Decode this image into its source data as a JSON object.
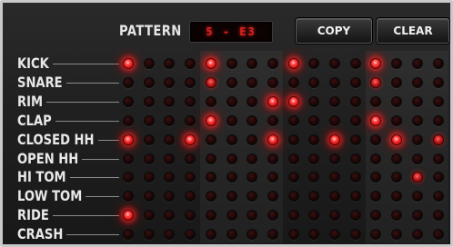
{
  "pattern": {
    "label": "PATTERN",
    "value": "5 - E3"
  },
  "buttons": {
    "copy_label": "COPY",
    "clear_label": "CLEAR"
  },
  "colors": {
    "led_on": "#ff2a2a",
    "led_off": "#2a0a0a",
    "panel_background": "#222222",
    "label_text": "#e8e8e8"
  },
  "steps_per_row": 16,
  "rows": [
    {
      "label": "KICK",
      "active_steps": [
        1,
        5,
        9,
        13
      ],
      "dim_steps": []
    },
    {
      "label": "SNARE",
      "active_steps": [],
      "dim_steps": [
        5,
        13
      ]
    },
    {
      "label": "RIM",
      "active_steps": [
        8,
        9
      ],
      "dim_steps": []
    },
    {
      "label": "CLAP",
      "active_steps": [
        5,
        13
      ],
      "dim_steps": []
    },
    {
      "label": "CLOSED HH",
      "active_steps": [
        1,
        4,
        8,
        11,
        14
      ],
      "dim_steps": [
        16
      ]
    },
    {
      "label": "OPEN HH",
      "active_steps": [],
      "dim_steps": []
    },
    {
      "label": "HI TOM",
      "active_steps": [],
      "dim_steps": [
        15
      ]
    },
    {
      "label": "LOW TOM",
      "active_steps": [],
      "dim_steps": []
    },
    {
      "label": "RIDE",
      "active_steps": [
        1
      ],
      "dim_steps": []
    },
    {
      "label": "CRASH",
      "active_steps": [],
      "dim_steps": []
    }
  ]
}
